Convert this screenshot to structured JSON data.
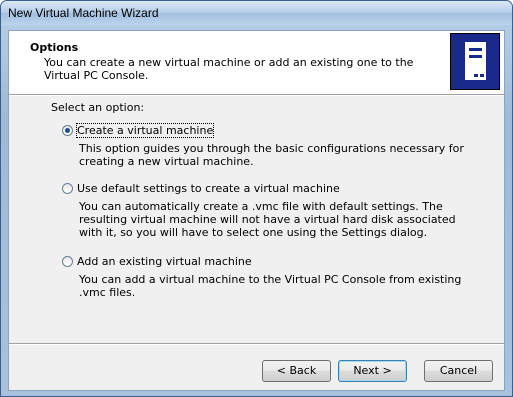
{
  "window": {
    "title": "New Virtual Machine Wizard"
  },
  "header": {
    "title": "Options",
    "description": "You can create a new virtual machine or add an existing one to the Virtual PC Console."
  },
  "main": {
    "select_label": "Select an option:",
    "options": [
      {
        "label": "Create a virtual machine",
        "description": "This option guides you through the basic configurations necessary for creating a new virtual machine.",
        "selected": true
      },
      {
        "label": "Use default settings to create a virtual machine",
        "description": "You can automatically create a .vmc file with default settings. The resulting virtual machine will not have a virtual hard disk associated with it, so you will have to select one using the Settings dialog.",
        "selected": false
      },
      {
        "label": "Add an existing virtual machine",
        "description": "You can add a virtual machine to the Virtual PC Console from existing .vmc files.",
        "selected": false
      }
    ]
  },
  "footer": {
    "back_label": "< Back",
    "next_label": "Next >",
    "cancel_label": "Cancel"
  }
}
